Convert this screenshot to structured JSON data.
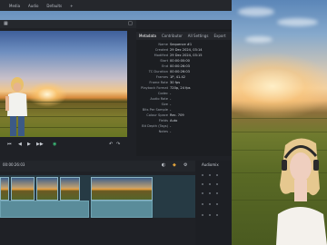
{
  "menu": [
    "Media",
    "Audio",
    "Defaults"
  ],
  "inspector_tabs": [
    "Metadata",
    "Contributor",
    "All Settings",
    "Export"
  ],
  "metadata": [
    {
      "key": "Name",
      "value": "Sequence #1"
    },
    {
      "key": "Created",
      "value": "29 Dec 2024, 03:14"
    },
    {
      "key": "Modified",
      "value": "29 Dec 2024, 03:15"
    },
    {
      "key": "Start",
      "value": "00:00:00:00"
    },
    {
      "key": "End",
      "value": "00:00:26:03"
    },
    {
      "key": "TC Duration",
      "value": "00:00:26:03"
    },
    {
      "key": "Frames",
      "value": "1P, 41.42"
    },
    {
      "key": "Frame Rate",
      "value": "30 fps"
    },
    {
      "key": "Playback Format",
      "value": "720p, 24 fps"
    },
    {
      "key": "Codec",
      "value": "-"
    },
    {
      "key": "Audio Rate",
      "value": "-"
    },
    {
      "key": "Size",
      "value": "-"
    },
    {
      "key": "Bits Per Sample",
      "value": "-"
    },
    {
      "key": "Colour Space",
      "value": "Rec. 709"
    },
    {
      "key": "Fields",
      "value": "Auto"
    },
    {
      "key": "Bit Depth (Tags)",
      "value": "-"
    },
    {
      "key": "Notes",
      "value": "-"
    }
  ],
  "audio_panel_title": "Audiomix",
  "timecode": "00:00:26:03",
  "colors": {
    "accent": "#5a8c9a",
    "panel": "#1f2126"
  }
}
